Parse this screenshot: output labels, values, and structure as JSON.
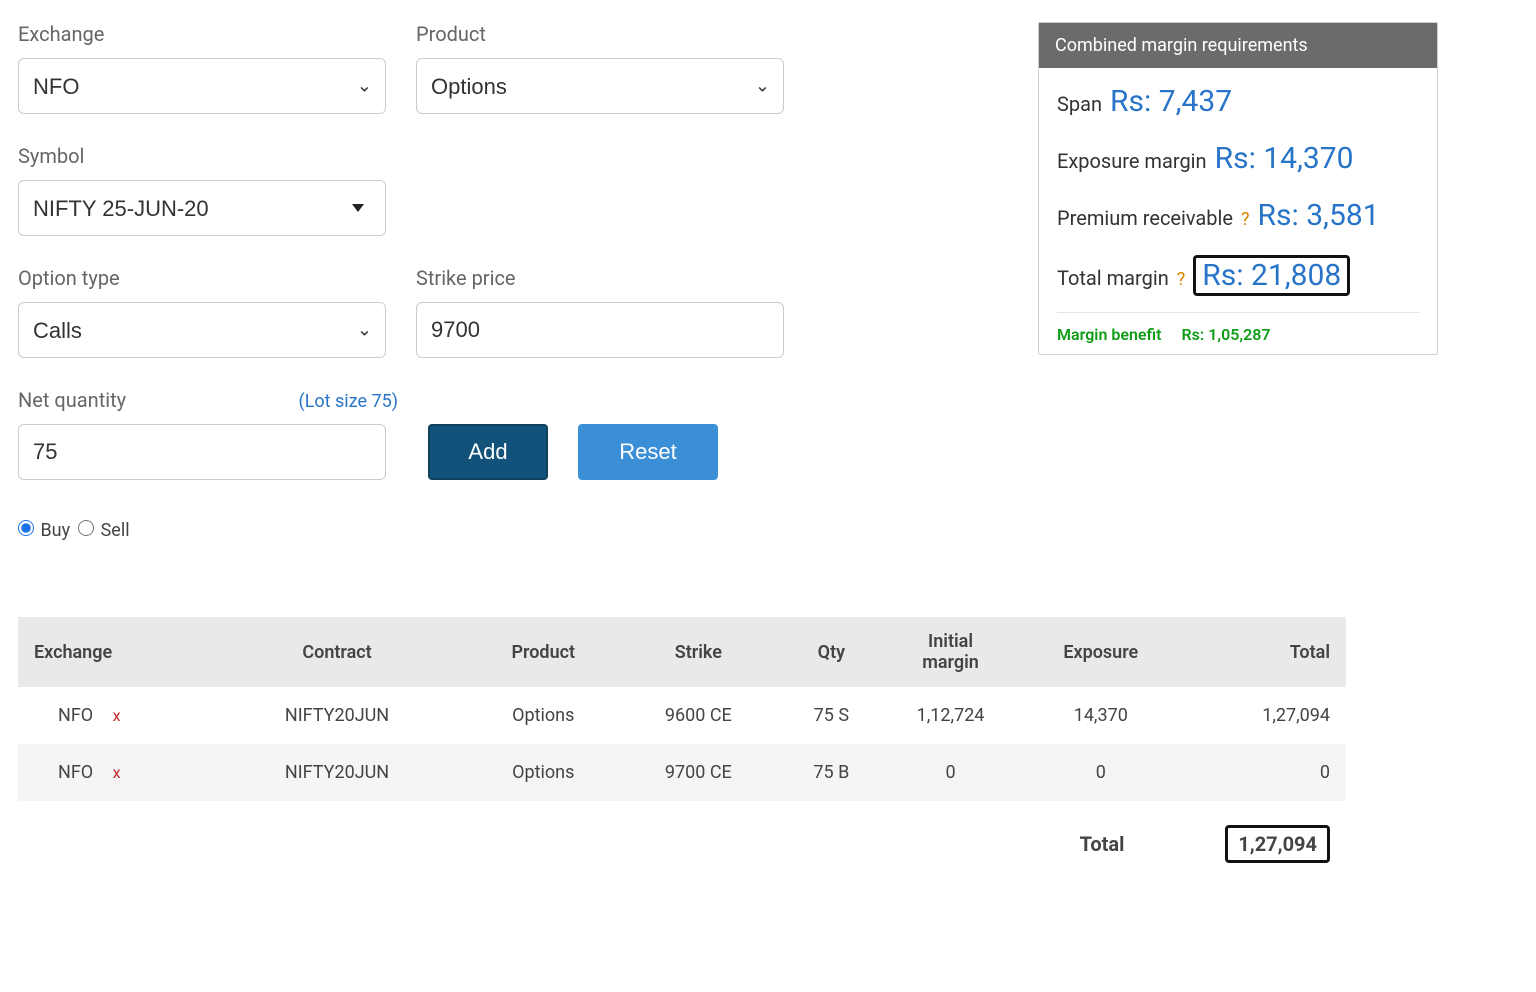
{
  "form": {
    "exchange": {
      "label": "Exchange",
      "value": "NFO"
    },
    "product": {
      "label": "Product",
      "value": "Options"
    },
    "symbol": {
      "label": "Symbol",
      "value": "NIFTY 25-JUN-20"
    },
    "option_type": {
      "label": "Option type",
      "value": "Calls"
    },
    "strike_price": {
      "label": "Strike price",
      "value": "9700"
    },
    "net_qty": {
      "label": "Net quantity",
      "value": "75",
      "lotsize_text": "(Lot size 75)"
    },
    "add_label": "Add",
    "reset_label": "Reset",
    "buy_label": "Buy",
    "sell_label": "Sell",
    "side_selected": "buy"
  },
  "summary": {
    "header": "Combined margin requirements",
    "span": {
      "label": "Span",
      "value": "Rs: 7,437"
    },
    "exposure": {
      "label": "Exposure margin",
      "value": "Rs: 14,370"
    },
    "premium": {
      "label": "Premium receivable",
      "value": "Rs: 3,581"
    },
    "total": {
      "label": "Total margin",
      "value": "Rs: 21,808"
    },
    "benefit": {
      "label": "Margin benefit",
      "value": "Rs: 1,05,287"
    },
    "help_glyph": "?"
  },
  "table": {
    "headers": [
      "Exchange",
      "Contract",
      "Product",
      "Strike",
      "Qty",
      "Initial margin",
      "Exposure",
      "Total"
    ],
    "rows": [
      {
        "exchange": "NFO",
        "contract": "NIFTY20JUN",
        "product": "Options",
        "strike": "9600 CE",
        "qty": "75 S",
        "initial": "1,12,724",
        "exposure": "14,370",
        "total": "1,27,094"
      },
      {
        "exchange": "NFO",
        "contract": "NIFTY20JUN",
        "product": "Options",
        "strike": "9700 CE",
        "qty": "75 B",
        "initial": "0",
        "exposure": "0",
        "total": "0"
      }
    ],
    "total_label": "Total",
    "total_value": "1,27,094",
    "delete_glyph": "x"
  }
}
